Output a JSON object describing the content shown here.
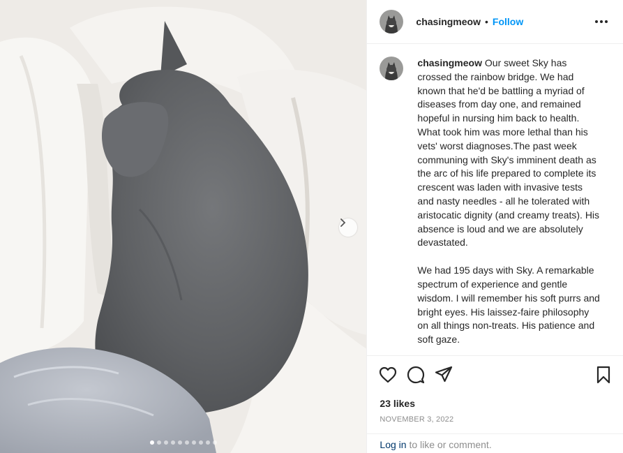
{
  "post": {
    "username": "chasingmeow",
    "separator": "•",
    "follow_label": "Follow",
    "more_icon": "more-options-icon",
    "caption_paragraphs": [
      "Our sweet Sky has crossed the rainbow bridge. We had known that he'd be battling a myriad of diseases from day one, and remained hopeful in nursing him back to health. What took him was more lethal than his vets' worst diagnoses.The past week communing with Sky's imminent death as the arc of his life prepared to complete its crescent was laden with invasive tests and nasty needles - all he tolerated with aristocatic dignity (and creamy treats). His absence is loud and we are absolutely devastated.",
      "We had 195 days with Sky. A remarkable spectrum of experience and gentle wisdom. I will remember his soft purrs and bright eyes. His laissez-faire philosophy on all things non-treats. His patience and soft gaze."
    ],
    "likes": "23 likes",
    "date": "NOVEMBER 3, 2022",
    "login_link": "Log in",
    "login_rest": " to like or comment."
  },
  "media": {
    "current_slide": 1,
    "slide_count": 10,
    "next_icon": "chevron-right-icon"
  },
  "icons": {
    "like": "heart-icon",
    "comment": "comment-icon",
    "share": "share-icon",
    "save": "bookmark-icon"
  },
  "colors": {
    "link_blue": "#0095f6",
    "text": "#262626",
    "muted": "#8e8e8e",
    "login_link": "#00376b"
  }
}
